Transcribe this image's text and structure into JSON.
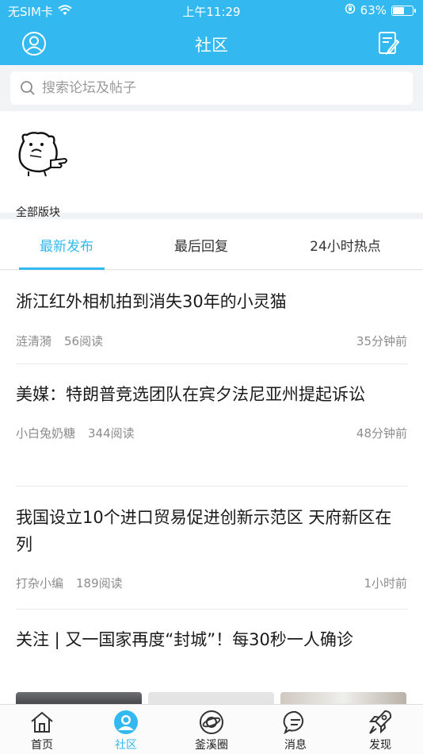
{
  "status_bar": {
    "carrier": "无SIM卡",
    "time": "上午11:29",
    "battery_pct": "63%",
    "battery_level": 0.63
  },
  "header": {
    "title": "社区"
  },
  "search": {
    "placeholder": "搜索论坛及帖子"
  },
  "boards": [
    {
      "label": "全部版块",
      "icon": "bear-mascot-icon"
    }
  ],
  "tabs": [
    {
      "label": "最新发布",
      "active": true
    },
    {
      "label": "最后回复",
      "active": false
    },
    {
      "label": "24小时热点",
      "active": false
    }
  ],
  "posts": [
    {
      "title": "浙江红外相机拍到消失30年的小灵猫",
      "author": "涟清漪",
      "reads": "56阅读",
      "time": "35分钟前"
    },
    {
      "title": "美媒：特朗普竞选团队在宾夕法尼亚州提起诉讼",
      "author": "小白兔奶糖",
      "reads": "344阅读",
      "time": "48分钟前"
    },
    {
      "title": "我国设立10个进口贸易促进创新示范区 天府新区在列",
      "author": "打杂小编",
      "reads": "189阅读",
      "time": "1小时前"
    },
    {
      "title": "关注 | 又一国家再度“封城”！每30秒一人确诊",
      "author": "",
      "reads": "",
      "time": ""
    }
  ],
  "bottom_tabs": [
    {
      "label": "首页",
      "icon": "home-icon",
      "active": false
    },
    {
      "label": "社区",
      "icon": "community-icon",
      "active": true
    },
    {
      "label": "釜溪圈",
      "icon": "planet-icon",
      "active": false
    },
    {
      "label": "消息",
      "icon": "message-icon",
      "active": false
    },
    {
      "label": "发现",
      "icon": "rocket-icon",
      "active": false
    }
  ],
  "colors": {
    "accent": "#33b9ef"
  }
}
